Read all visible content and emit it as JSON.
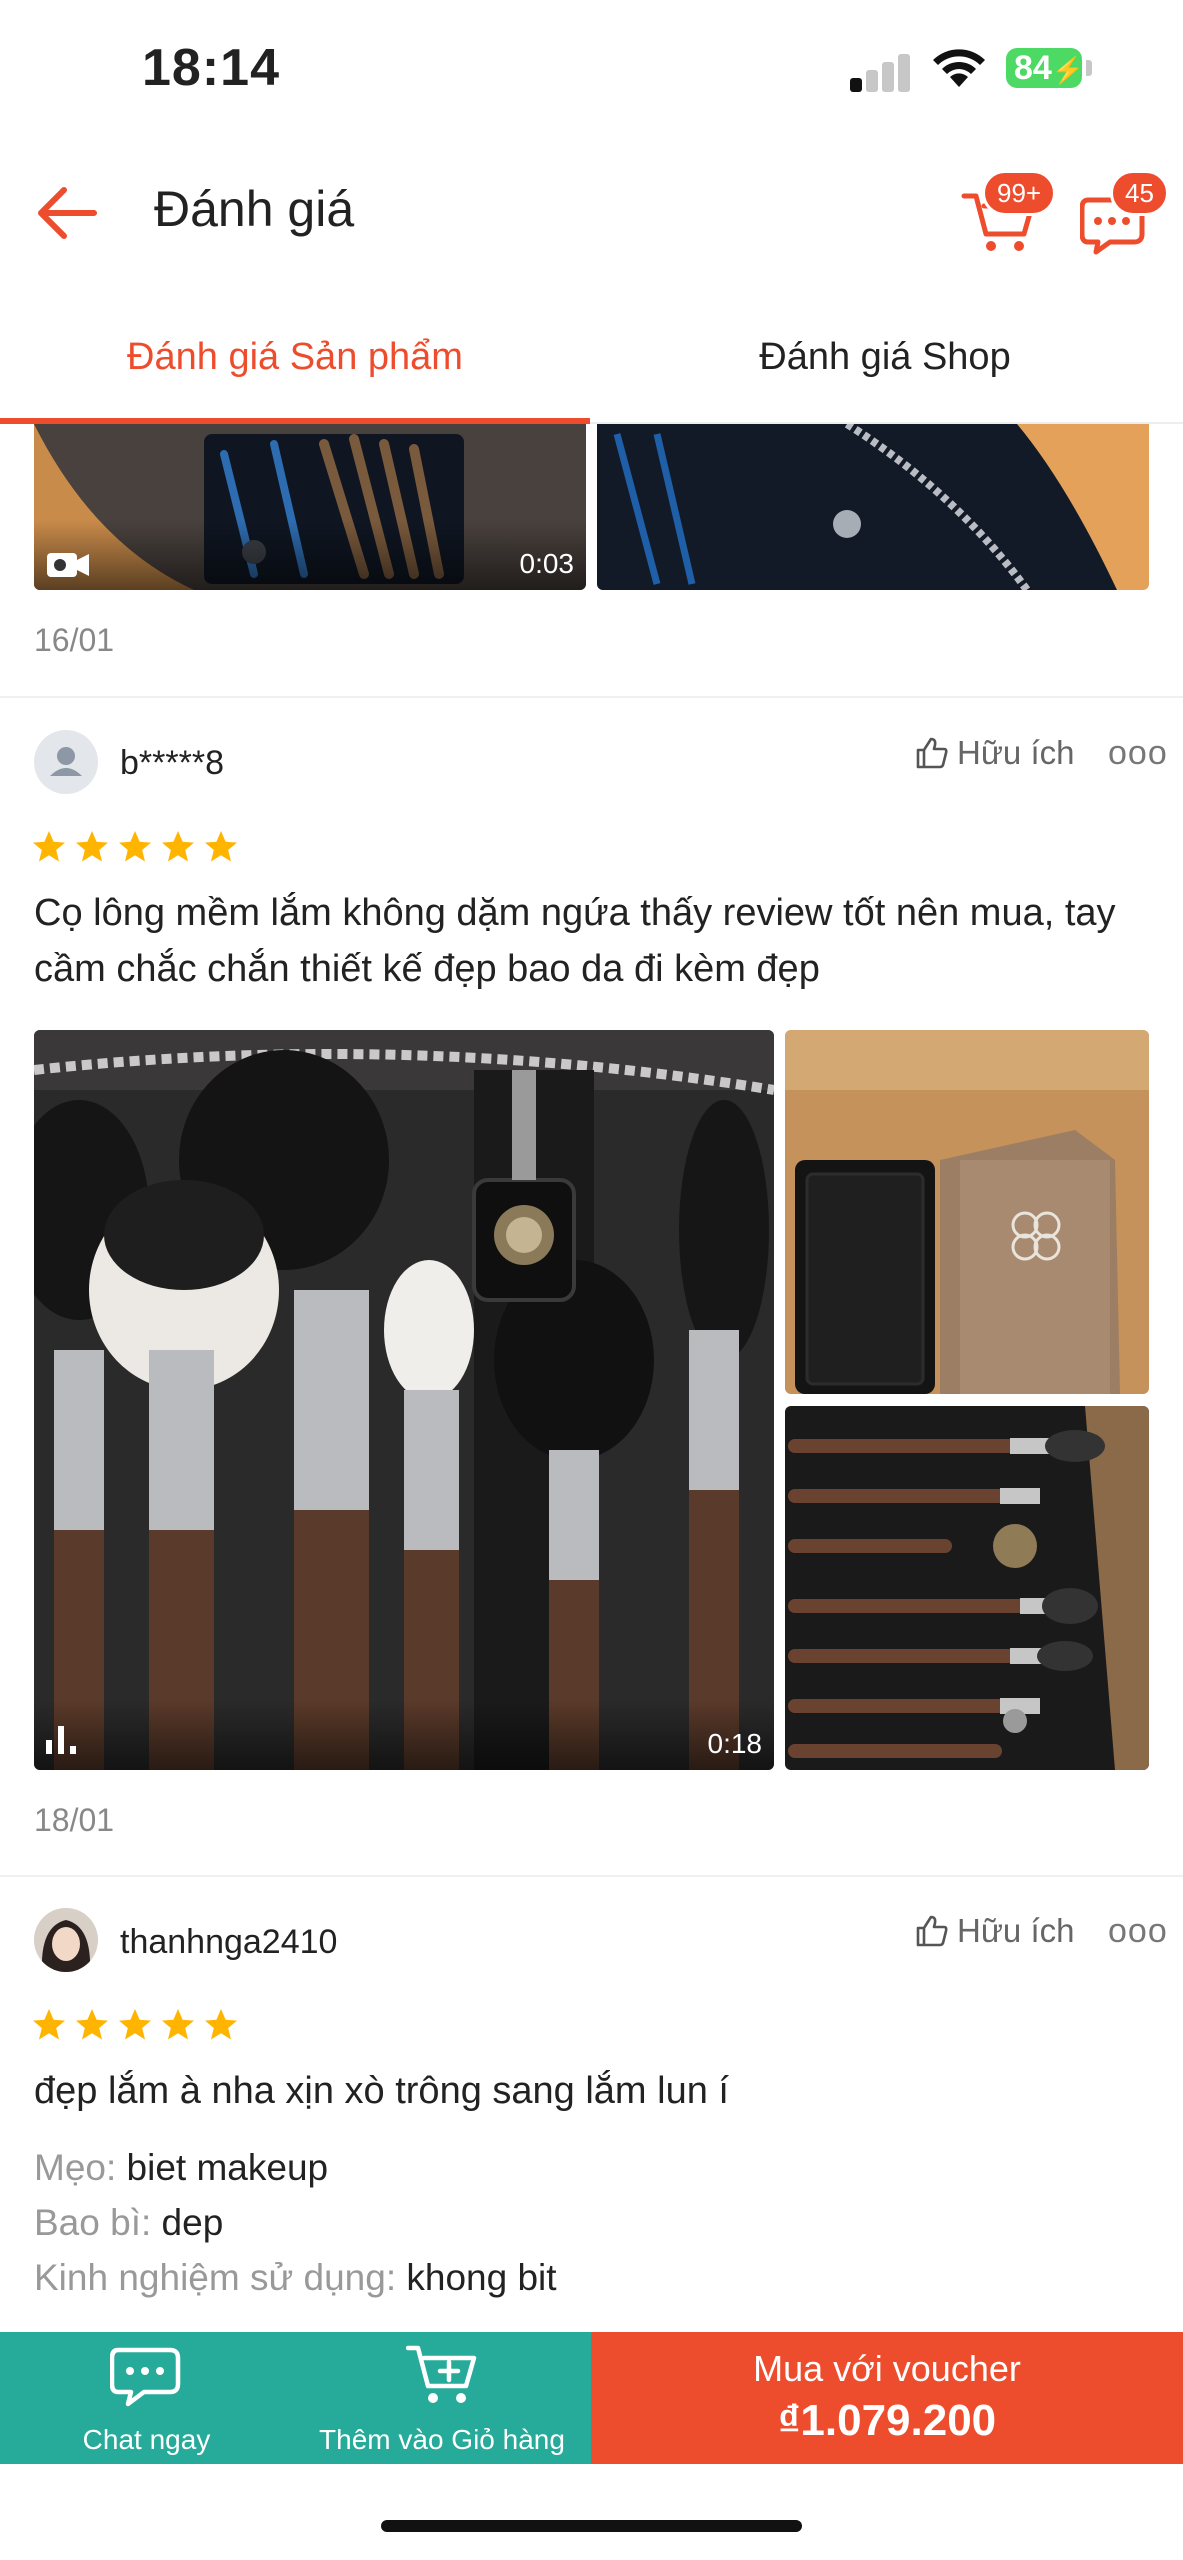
{
  "status_bar": {
    "time": "18:14",
    "battery": "84"
  },
  "header": {
    "title": "Đánh giá",
    "cart_badge": "99+",
    "chat_badge": "45"
  },
  "tabs": [
    {
      "label": "Đánh giá Sản phẩm",
      "active": true
    },
    {
      "label": "Đánh giá Shop",
      "active": false
    }
  ],
  "prev_review": {
    "video_duration": "0:03",
    "date": "16/01"
  },
  "reviews": [
    {
      "username": "b*****8",
      "helpful_label": "Hữu ích",
      "rating": 5,
      "text": "Cọ lông mềm lắm không dặm ngứa thấy review tốt nên mua, tay cầm chắc chắn thiết kế đẹp bao da đi kèm đẹp",
      "video_duration": "0:18",
      "date": "18/01"
    },
    {
      "username": "thanhnga2410",
      "helpful_label": "Hữu ích",
      "rating": 5,
      "text": "đẹp lắm à nha xịn xò trông sang lắm lun í",
      "attributes": [
        {
          "key": "Mẹo:",
          "value": "biet makeup"
        },
        {
          "key": "Bao bì:",
          "value": "dep"
        },
        {
          "key": "Kinh nghiệm sử dụng:",
          "value": "khong bit"
        }
      ]
    }
  ],
  "bottom_bar": {
    "chat_label": "Chat ngay",
    "cart_label": "Thêm vào Giỏ hàng",
    "buy_label": "Mua với voucher",
    "price": "₫1.079.200"
  },
  "colors": {
    "accent": "#ee4d2d",
    "teal": "#26aa99",
    "star": "#ffb400"
  }
}
